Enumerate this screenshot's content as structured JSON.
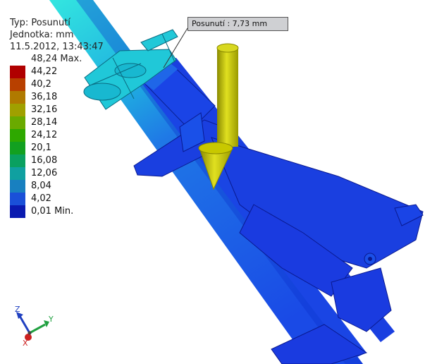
{
  "legend": {
    "type_line": "Typ: Posunutí",
    "unit_line": "Jednotka: mm",
    "date_line": "11.5.2012, 13:43:47",
    "max_label": "48,24 Max.",
    "rows": [
      {
        "label": "44,22",
        "color": "#b00000"
      },
      {
        "label": "40,2",
        "color": "#b84000"
      },
      {
        "label": "36,18",
        "color": "#b07a00"
      },
      {
        "label": "32,16",
        "color": "#a0a000"
      },
      {
        "label": "28,14",
        "color": "#6aaa00"
      },
      {
        "label": "24,12",
        "color": "#2ea800"
      },
      {
        "label": "20,1",
        "color": "#12a020"
      },
      {
        "label": "16,08",
        "color": "#0aa060"
      },
      {
        "label": "12,06",
        "color": "#10a0a0"
      },
      {
        "label": "8,04",
        "color": "#1880c0"
      },
      {
        "label": "4,02",
        "color": "#1a50d8"
      },
      {
        "label": "0,01 Min.",
        "color": "#0a1ab0"
      }
    ]
  },
  "callout": {
    "text": "Posunutí : 7,73 mm"
  },
  "triad": {
    "x_label": "X",
    "y_label": "Y",
    "z_label": "Z",
    "x_color": "#cc2020",
    "y_color": "#20a040",
    "z_color": "#2040c0"
  },
  "colors": {
    "model_main": "#1a3fe0",
    "model_dark": "#0a20b0",
    "model_light": "#1f66e8",
    "tube_cyan": "#28d8d8",
    "arrow_yellow": "#c8c800"
  }
}
